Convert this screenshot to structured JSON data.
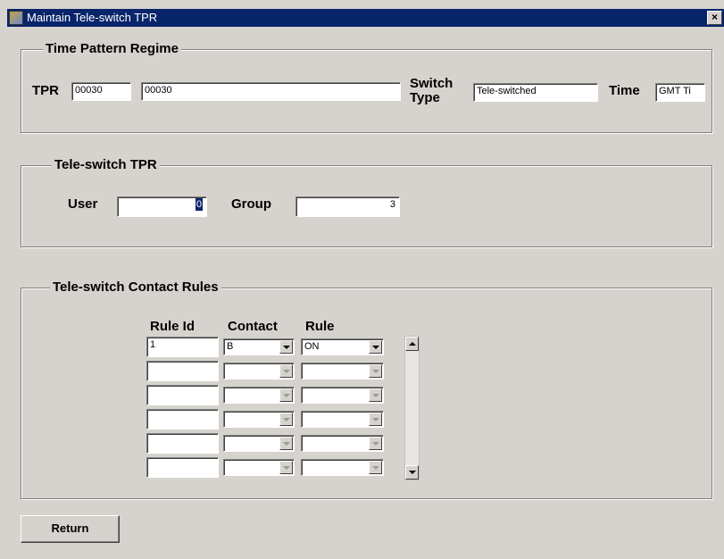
{
  "window": {
    "title": "Maintain Tele-switch TPR",
    "close_glyph": "×"
  },
  "tpr_section": {
    "legend": "Time Pattern Regime",
    "tpr_label": "TPR",
    "tpr_code": "00030",
    "tpr_description": "00030",
    "switch_label_1": "Switch",
    "switch_label_2": "Type",
    "switch_type": "Tele-switched",
    "time_label": "Time",
    "time_value": "GMT Ti"
  },
  "teleswitch_section": {
    "legend": "Tele-switch TPR",
    "user_label": "User",
    "user_value": "0",
    "group_label": "Group",
    "group_value": "3"
  },
  "rules_section": {
    "legend": "Tele-switch Contact Rules",
    "columns": [
      "Rule Id",
      "Contact",
      "Rule"
    ],
    "rows": [
      {
        "rule_id": "1",
        "contact": "B",
        "rule": "ON"
      },
      {
        "rule_id": "",
        "contact": "",
        "rule": ""
      },
      {
        "rule_id": "",
        "contact": "",
        "rule": ""
      },
      {
        "rule_id": "",
        "contact": "",
        "rule": ""
      },
      {
        "rule_id": "",
        "contact": "",
        "rule": ""
      },
      {
        "rule_id": "",
        "contact": "",
        "rule": ""
      }
    ]
  },
  "buttons": {
    "return_label": "Return"
  }
}
